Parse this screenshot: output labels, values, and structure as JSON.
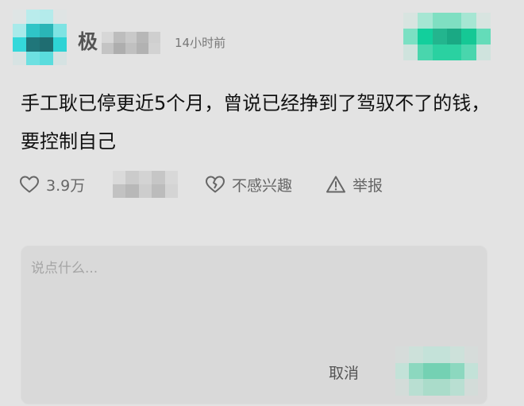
{
  "post": {
    "author_initial": "极",
    "time": "14小时前",
    "text": "手工耿已停更近5个月，曾说已经挣到了驾驭不了的钱，要控制自己"
  },
  "actions": {
    "like_count": "3.9万",
    "dislike_label": "不感兴趣",
    "report_label": "举报"
  },
  "comment": {
    "placeholder": "说点什么...",
    "cancel_label": "取消"
  },
  "icons": {
    "like": "heart-icon",
    "dislike": "broken-heart-icon",
    "report": "warning-triangle-icon"
  },
  "colors": {
    "background": "#e3e3e3",
    "accent_teal": "#1fd6a4",
    "avatar_cyan": "#2ad9db"
  }
}
